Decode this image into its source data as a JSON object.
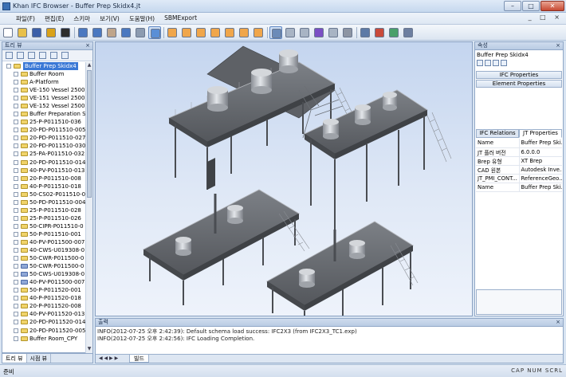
{
  "window": {
    "title": "Khan IFC Browser - Buffer Prep Skidx4.jt",
    "minimize": "–",
    "maximize": "□",
    "close": "✕"
  },
  "menu": {
    "items": [
      "파일(F)",
      "편집(E)",
      "스키마",
      "보기(V)",
      "도움말(H)",
      "SBMExport"
    ],
    "system_icons": "_ □ ×"
  },
  "toolbar": {
    "buttons": [
      {
        "icon": "new-file-icon",
        "color": "#ffffff"
      },
      {
        "icon": "open-folder-icon",
        "color": "#e8c04a"
      },
      {
        "icon": "save-icon",
        "color": "#3b5fa8"
      },
      {
        "icon": "settings-icon",
        "color": "#d9a21a"
      },
      {
        "icon": "help-icon",
        "color": "#2d2d2d"
      },
      {
        "icon": "zoom-in-icon",
        "color": "#4a78c0"
      },
      {
        "icon": "zoom-window-icon",
        "color": "#4a78c0"
      },
      {
        "icon": "pan-hand-icon",
        "color": "#bfa58a"
      },
      {
        "icon": "zoom-out-icon",
        "color": "#4a78c0"
      },
      {
        "icon": "envelope-icon",
        "color": "#8c9bb0"
      },
      {
        "icon": "select-icon",
        "color": "#5a8fd6"
      },
      {
        "icon": "cube-view-iso-icon",
        "color": "#f0a64a"
      },
      {
        "icon": "cube-view-front-icon",
        "color": "#f0a64a"
      },
      {
        "icon": "cube-view-back-icon",
        "color": "#f0a64a"
      },
      {
        "icon": "cube-view-left-icon",
        "color": "#f0a64a"
      },
      {
        "icon": "cube-view-right-icon",
        "color": "#f0a64a"
      },
      {
        "icon": "cube-view-top-icon",
        "color": "#f0a64a"
      },
      {
        "icon": "cube-view-bottom-icon",
        "color": "#f0a64a"
      },
      {
        "icon": "shaded-mode-icon",
        "color": "#6b8bb8"
      },
      {
        "icon": "wireframe-mode-icon",
        "color": "#a8b4c4"
      },
      {
        "icon": "hidden-line-icon",
        "color": "#a8b4c4"
      },
      {
        "icon": "color-cube-icon",
        "color": "#7b4fc4"
      },
      {
        "icon": "transparent-cube-icon",
        "color": "#a8b4c4"
      },
      {
        "icon": "gray-cube-icon",
        "color": "#8d95a3"
      },
      {
        "icon": "section-icon",
        "color": "#5d7aa6"
      },
      {
        "icon": "measure-icon",
        "color": "#c94a3a"
      },
      {
        "icon": "camera-icon",
        "color": "#4aa06a"
      },
      {
        "icon": "markup-icon",
        "color": "#6d7fa0"
      }
    ]
  },
  "tree": {
    "header": "트리 뷰",
    "close": "×",
    "root": "Buffer Prep Skidx4",
    "items": [
      "Buffer Room",
      "A-Platform",
      "VE-150 Vessel 2500l",
      "VE-151 Vessel 2500l",
      "VE-152 Vessel 2500l",
      "Buffer Preparation Sk",
      "25-P-P011510-036",
      "20-PD-P011510-005",
      "20-PD-P011510-027",
      "20-PD-P011510-030",
      "25-PA-P011510-032",
      "20-PD-P011510-014",
      "40-PV-P011510-013",
      "20-P-P011510-008",
      "40-P-P011510-018",
      "50-CS02-P011510-0",
      "50-PD-P011510-004",
      "25-P-P011510-028",
      "25-P-P011510-026",
      "50-CIPR-P011510-0",
      "50-P-P011510-001",
      "40-PV-P011500-007",
      "40-CWS-U019308-0",
      "50-CWR-P011500-0",
      "50-CWR-P011500-0",
      "50-CWS-U019308-0",
      "40-PV-P011500-007",
      "50-P-P011520-001",
      "40-P-P011520-018",
      "20-P-P011520-008",
      "40-PV-P011520-013",
      "20-PD-P011520-014",
      "20-PD-P011520-005",
      "Buffer Room_CPY"
    ],
    "alt_icon_rows": [
      24,
      25,
      26
    ]
  },
  "left_tabs": [
    "트리 뷰",
    "시점 뷰"
  ],
  "properties": {
    "header": "속성",
    "close": "×",
    "selection_name": "Buffer Prep Skidx4",
    "sections": [
      "IFC Properties",
      "Element Properties"
    ],
    "tabs": [
      "IFC Relations",
      "JT Properties"
    ],
    "active_tab": 1,
    "rows": [
      {
        "key": "Name",
        "value": "Buffer Prep Ski..."
      },
      {
        "key": "JT 플러 버전",
        "value": "6.0.0.0"
      },
      {
        "key": "Brep 유형",
        "value": "XT Brep"
      },
      {
        "key": "CAD 원본",
        "value": "Autodesk Inve..."
      },
      {
        "key": "JT_PMI_CONT...",
        "value": "ReferenceGeo..."
      },
      {
        "key": "Name",
        "value": "Buffer Prep Ski..."
      }
    ]
  },
  "output": {
    "header": "출력",
    "close": "×",
    "lines": [
      "INFO(2012-07-25 오후 2:42:39): Default schema load success: IFC2X3 (from IFC2X3_TC1.exp)",
      "INFO(2012-07-25 오후 2:42:56): IFC Loading Completion."
    ],
    "nav_arrows": "◀ ◀ ▶ ▶",
    "tab": "빌드"
  },
  "status": {
    "text": "준비",
    "indicators": "CAP  NUM  SCRL"
  },
  "colors": {
    "selection": "#3a78d6",
    "viewport_top": "#c4d5ef",
    "viewport_bottom": "#eef3fb",
    "platform": "#6e7176",
    "tank": "#c9ccd1"
  }
}
